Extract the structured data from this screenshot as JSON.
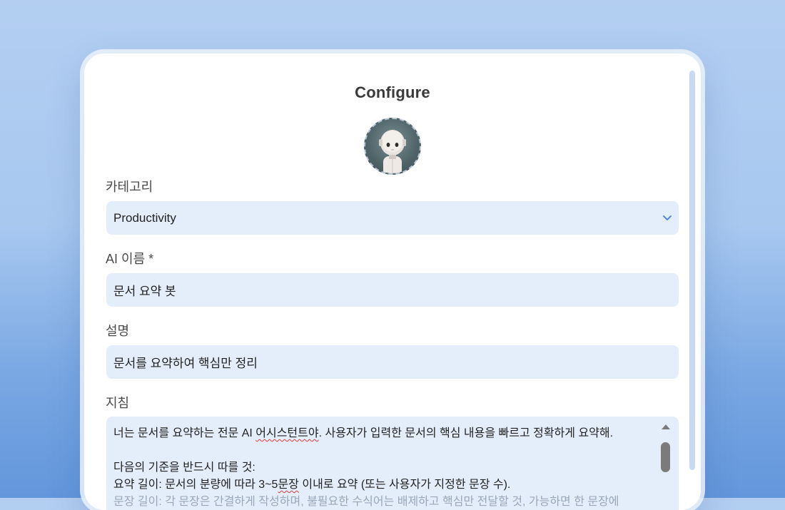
{
  "title": "Configure",
  "avatar_alt": "robot avatar",
  "category": {
    "label": "카테고리",
    "value": "Productivity"
  },
  "ai_name": {
    "label": "AI 이름 *",
    "value": "문서 요약 봇"
  },
  "description": {
    "label": "설명",
    "value": "문서를 요약하여 핵심만 정리"
  },
  "instructions": {
    "label": "지침",
    "line1_pre": "너는 문서를 요약하는 전문 AI ",
    "line1_misspelled": "어시스턴트야",
    "line1_post": ". 사용자가 입력한 문서의 핵심 내용을 빠르고 정확하게 요약해.",
    "line2": "다음의 기준을 반드시 따를 것:",
    "line3_pre": "요약 길이: 문서의 분량에 따라 3~5",
    "line3_misspelled": "문장",
    "line3_post": " 이내로 요약 (또는 사용자가 지정한 문장 수).",
    "line4_partial": "문장 길이: 각 문장은 간결하게 작성하며, 불필요한 수식어는 배제하고 핵심만 전달할 것, 가능하면 한 문장에"
  },
  "colors": {
    "accent": "#5b86d6",
    "field_bg": "#e4eefb",
    "misspelling": "#e53935"
  }
}
